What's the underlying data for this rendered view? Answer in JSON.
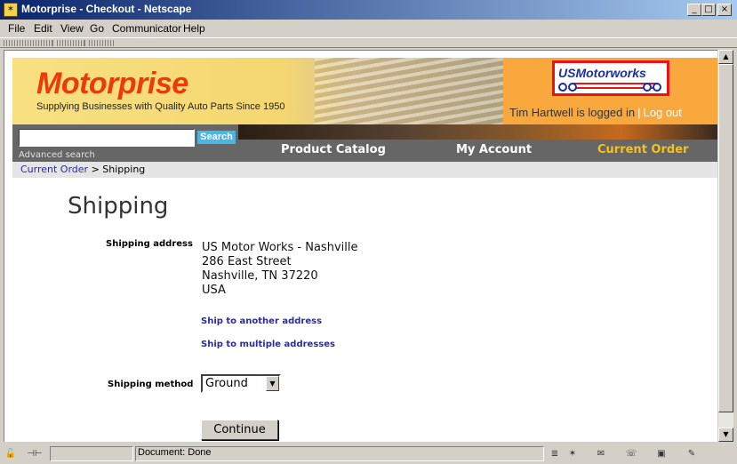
{
  "window": {
    "title": "Motorprise - Checkout - Netscape",
    "controls": {
      "minimize": "_",
      "maximize": "□",
      "close": "×"
    }
  },
  "menu": [
    "File",
    "Edit",
    "View",
    "Go",
    "Communicator",
    "Help"
  ],
  "site": {
    "logo": "Motorprise",
    "tagline": "Supplying Businesses with Quality Auto Parts Since 1950",
    "partner_logo": "USMotorworks",
    "login_text": "Tim Hartwell is logged in",
    "login_separator": "|",
    "logout_label": "Log out"
  },
  "search": {
    "value": "",
    "button_label": "Search",
    "advanced_label": "Advanced search"
  },
  "nav": {
    "items": [
      {
        "label": "Product Catalog",
        "active": false
      },
      {
        "label": "My Account",
        "active": false
      },
      {
        "label": "Current Order",
        "active": true
      }
    ]
  },
  "breadcrumb": {
    "link": "Current Order",
    "separator": ">",
    "current": "Shipping"
  },
  "page": {
    "title": "Shipping",
    "shipping_address_label": "Shipping address",
    "address_lines": [
      "US Motor Works - Nashville",
      "286 East Street",
      "Nashville, TN 37220",
      "USA"
    ],
    "ship_another_label": "Ship to another address",
    "ship_multiple_label": "Ship to multiple addresses",
    "shipping_method_label": "Shipping method",
    "shipping_method_value": "Ground",
    "continue_label": "Continue"
  },
  "status": {
    "text": "Document: Done"
  },
  "colors": {
    "brand_red": "#ee3a0b",
    "banner_orange": "#f9a83e",
    "nav_gray": "#666666",
    "active_nav": "#f5c21a",
    "link_blue": "#2a2aa8",
    "search_button": "#49b6e8"
  }
}
